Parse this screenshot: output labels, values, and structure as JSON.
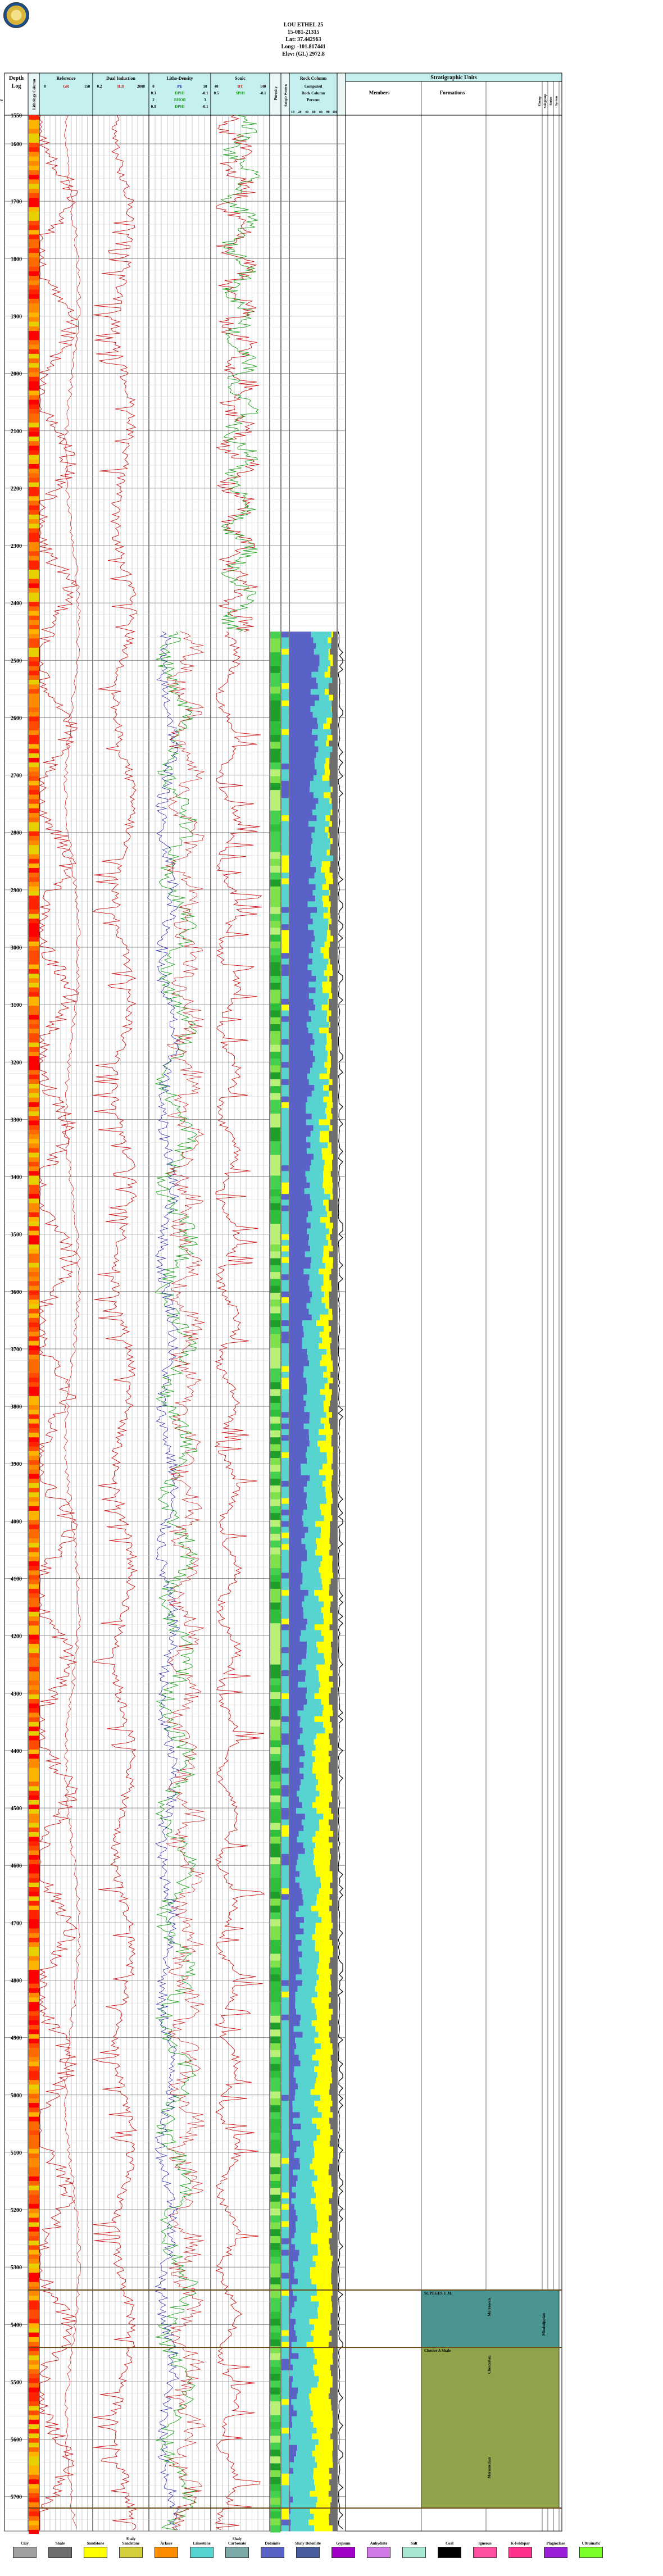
{
  "header": {
    "lines": [
      "LOU ETHEL 25",
      "15-081-21315",
      "Lat: 37.442963",
      "Long: -101.817441",
      "Elev: (GL) 2972.8"
    ]
  },
  "logo_icon": "kgs-seal-logo",
  "tracks": {
    "depth": {
      "title_top": "Depth",
      "title_bottom": "Log"
    },
    "lith_strip": {
      "title": "Lithology Column"
    },
    "reference": {
      "title": "Reference",
      "curves": [
        "GR",
        "SP"
      ],
      "scale": [
        "0",
        "GR",
        "150"
      ]
    },
    "induction": {
      "title": "Dual Induction",
      "curves": [
        "ILD"
      ],
      "scale": [
        "0.2",
        "ILD",
        "2000"
      ]
    },
    "density": {
      "title": "Litho-Density",
      "rows": [
        [
          "0",
          "PE",
          "10"
        ],
        [
          "0.3",
          "DPHI",
          "-0.1"
        ],
        [
          "2",
          "RHOB",
          "3"
        ],
        [
          "0.3",
          "DPHI",
          "-0.1"
        ]
      ]
    },
    "sonic": {
      "title": "Sonic",
      "rows": [
        [
          "40",
          "DT",
          "140"
        ],
        [
          "0.5",
          "SPHI",
          "-0.1"
        ]
      ]
    },
    "porosity_col": {
      "title": "Porosity"
    },
    "thin_col": {
      "title": "Sample Pattern"
    },
    "rock_col": {
      "title": "Rock Column",
      "rows": [
        "Computed",
        "Rock Column",
        "Percent"
      ],
      "ticks": [
        "10",
        "20",
        "40",
        "60",
        "80",
        "90",
        "100"
      ]
    },
    "stratigraphy": {
      "title": "Stratigraphic Units",
      "members": "Members",
      "formations": "Formations",
      "extra_cols": [
        "Group",
        "Subgroup",
        "Series",
        "System",
        "Era"
      ]
    }
  },
  "depth_labels": [
    "1550",
    "1600",
    "1700",
    "1800",
    "1900",
    "2000",
    "2100",
    "2200",
    "2300",
    "2400",
    "2500",
    "2600",
    "2700",
    "2800",
    "2900",
    "3000",
    "3100",
    "3200",
    "3300",
    "3400",
    "3500",
    "3600",
    "3700",
    "3800",
    "3900",
    "4000",
    "4100",
    "4200",
    "4300",
    "4400",
    "4500",
    "4600",
    "4700",
    "4800",
    "4900",
    "5000",
    "5100",
    "5200",
    "5300",
    "5400",
    "5500",
    "5600",
    "5700"
  ],
  "strat_units": [
    {
      "member": "St. PEGES U.M.",
      "formation": "Morrowan"
    },
    {
      "member": "Chester A Shale",
      "formation": "Chesterian",
      "extra": "Meramecian"
    },
    {
      "member": "",
      "formation": "Mississippian"
    }
  ],
  "legend": [
    {
      "label": "Clay",
      "color": "#a0a0a0"
    },
    {
      "label": "Shale",
      "color": "#6e6e6e"
    },
    {
      "label": "Sandstone",
      "color": "#ffff00"
    },
    {
      "label": "Shaly Sandstone",
      "color": "#d4cf3a"
    },
    {
      "label": "Arkose",
      "color": "#ff8c00"
    },
    {
      "label": "Limestone",
      "color": "#57d3d0"
    },
    {
      "label": "Shaly Carbonate",
      "color": "#7aa9a7"
    },
    {
      "label": "Dolomite",
      "color": "#5a62c8"
    },
    {
      "label": "Shaly Dolomite",
      "color": "#4a5da0"
    },
    {
      "label": "Gypsum",
      "color": "#a000c8"
    },
    {
      "label": "Anhydrite",
      "color": "#d078e6"
    },
    {
      "label": "Salt",
      "color": "#a8e8d0"
    },
    {
      "label": "Coal",
      "color": "#000000"
    },
    {
      "label": "Igneous",
      "color": "#ff4fa0"
    },
    {
      "label": "K-Feldspar",
      "color": "#ff2f8c"
    },
    {
      "label": "Plagioclase",
      "color": "#9b1fd8"
    },
    {
      "label": "Ultramafic",
      "color": "#7bff2a"
    }
  ],
  "colors": {
    "gr_curve": "#cc1010",
    "ild_curve": "#cc1010",
    "dphi_curve": "#19a019",
    "pe_curve": "#1515a0",
    "strat_fill_upper": "#4a9590",
    "strat_fill_lower": "#8ea34a",
    "header_bg": "#c6f0f0"
  },
  "chart_data": {
    "type": "line",
    "title": "LOU ETHEL 25",
    "xlabel": "",
    "ylabel": "Depth",
    "ylim": [
      1550,
      5760
    ],
    "log_interval_ft": [
      1550,
      5760
    ],
    "tracks": [
      "Reference (GR, SP)",
      "Dual Induction (ILD)",
      "Litho-Density (PE, DPHI, RHOB)",
      "Sonic (DT, SPHI)",
      "Rock Column (Percent)"
    ],
    "series": [
      {
        "name": "GR",
        "x_range": [
          0,
          150
        ],
        "depth_range": [
          1550,
          5760
        ]
      },
      {
        "name": "ILD",
        "x_range": [
          0.2,
          2000
        ],
        "depth_range": [
          1550,
          5760
        ]
      },
      {
        "name": "DPHI",
        "x_range": [
          0.3,
          -0.1
        ],
        "depth_range": [
          2450,
          5760
        ]
      },
      {
        "name": "DT",
        "x_range": [
          40,
          140
        ],
        "depth_range": [
          1550,
          2450
        ]
      }
    ]
  }
}
